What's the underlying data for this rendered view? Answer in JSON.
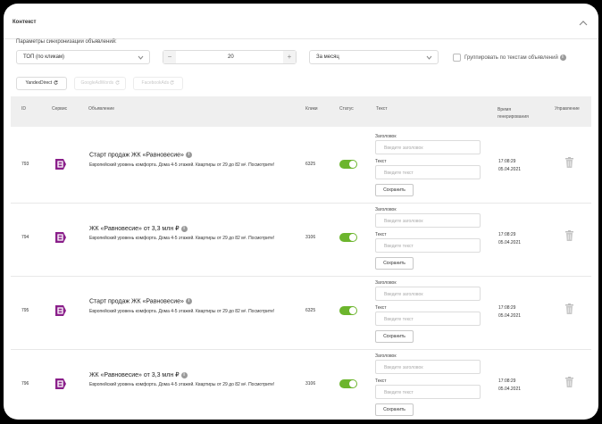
{
  "section": {
    "title": "Контекст"
  },
  "params": {
    "label": "Параметры синхронизации объявлений:",
    "top_select": "ТОП (по кликам)",
    "count": "20",
    "minus": "−",
    "plus": "+",
    "period_select": "За месяц",
    "group_label": "Группировать по текстам объявлений"
  },
  "sources": [
    {
      "label": "YandexDirect",
      "state": "active"
    },
    {
      "label": "GoogleAdWords",
      "state": "disabled"
    },
    {
      "label": "FacebookAds",
      "state": "disabled"
    }
  ],
  "table": {
    "headers": {
      "id": "ID",
      "service": "Сервис",
      "ad": "Объявление",
      "clicks": "Клики",
      "status": "Статус",
      "text": "Текст",
      "time": "Время генерирования",
      "manage": "Управление"
    },
    "labels": {
      "heading": "Заголовок",
      "heading_placeholder": "Введите заголовок",
      "text": "Текст",
      "text_placeholder": "Введите текст",
      "save": "Сохранить"
    },
    "rows": [
      {
        "id": "793",
        "title": "Старт продаж ЖК «Равновесие»",
        "desc": "Европейский уровень комфорта. Дома 4-5 этажей. Квартиры от 29 до 82 м². Посмотрите!",
        "clicks": "6325",
        "status_on": true,
        "time": "17:08:29",
        "date": "05.04.2021"
      },
      {
        "id": "794",
        "title": "ЖК «Равновесие» от 3,3 млн ₽",
        "desc": "Европейский уровень комфорта. Дома 4-5 этажей. Квартиры от 29 до 82 м². Посмотрите!",
        "clicks": "3106",
        "status_on": true,
        "time": "17:08:29",
        "date": "05.04.2021"
      },
      {
        "id": "795",
        "title": "Старт продаж ЖК «Равновесие»",
        "desc": "Европейский уровень комфорта. Дома 4-5 этажей. Квартиры от 29 до 82 м². Посмотрите!",
        "clicks": "6325",
        "status_on": true,
        "time": "17:08:29",
        "date": "05.04.2021"
      },
      {
        "id": "796",
        "title": "ЖК «Равновесие» от 3,3 млн ₽",
        "desc": "Европейский уровень комфорта. Дома 4-5 этажей. Квартиры от 29 до 82 м². Посмотрите!",
        "clicks": "3106",
        "status_on": true,
        "time": "17:08:29",
        "date": "05.04.2021"
      }
    ]
  },
  "colors": {
    "accent_green": "#6cb52d",
    "service_purple": "#8a1f8a",
    "header_bg": "#efefef"
  },
  "icons": {
    "collapse": "chevron-up-icon",
    "info": "info-icon",
    "refresh": "refresh-icon",
    "service": "yandex-direct-icon",
    "delete": "trash-icon"
  }
}
